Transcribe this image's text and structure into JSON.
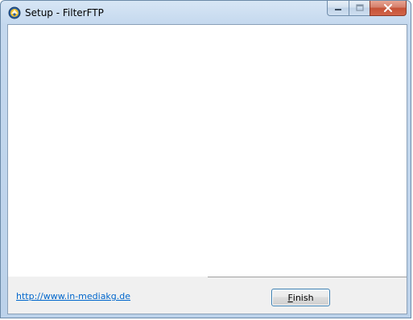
{
  "window": {
    "title": "Setup - FilterFTP",
    "icon": "filterftp-app-icon",
    "caption_buttons": [
      "minimize-icon",
      "maximize-icon",
      "close-icon"
    ]
  },
  "footer": {
    "link_text": "http://www.in-mediakg.de",
    "finish_button": {
      "mnemonic": "F",
      "rest": "inish"
    }
  },
  "colors": {
    "link": "#0066cc",
    "close_button": "#c55237",
    "frame": "#bcd2ea"
  }
}
